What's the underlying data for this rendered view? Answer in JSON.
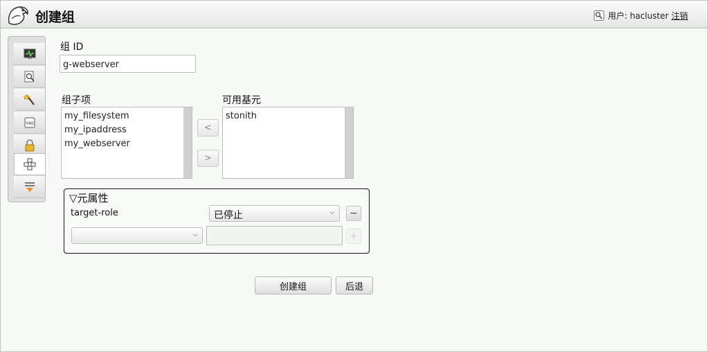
{
  "header": {
    "title": "创建组",
    "user_label": "用户: hacluster",
    "logout_label": "注销"
  },
  "sidebar": {
    "items": [
      {
        "name": "monitor-icon"
      },
      {
        "name": "search-doc-icon"
      },
      {
        "name": "wand-icon"
      },
      {
        "name": "id-tag-icon"
      },
      {
        "name": "lock-icon"
      },
      {
        "name": "resources-icon"
      },
      {
        "name": "filter-icon"
      }
    ],
    "active_index": 5
  },
  "form": {
    "group_id_label": "组 ID",
    "group_id_value": "g-webserver",
    "children_label": "组子项",
    "children": [
      "my_filesystem",
      "my_ipaddress",
      "my_webserver"
    ],
    "available_label": "可用基元",
    "available": [
      "stonith"
    ],
    "move_left_label": "<",
    "move_right_label": ">"
  },
  "meta": {
    "title": "▽元属性",
    "rows": [
      {
        "key": "target-role",
        "value": "已停止",
        "action": "−"
      }
    ],
    "new_row": {
      "key": "",
      "value": "",
      "action": "+"
    }
  },
  "buttons": {
    "create": "创建组",
    "back": "后退"
  }
}
